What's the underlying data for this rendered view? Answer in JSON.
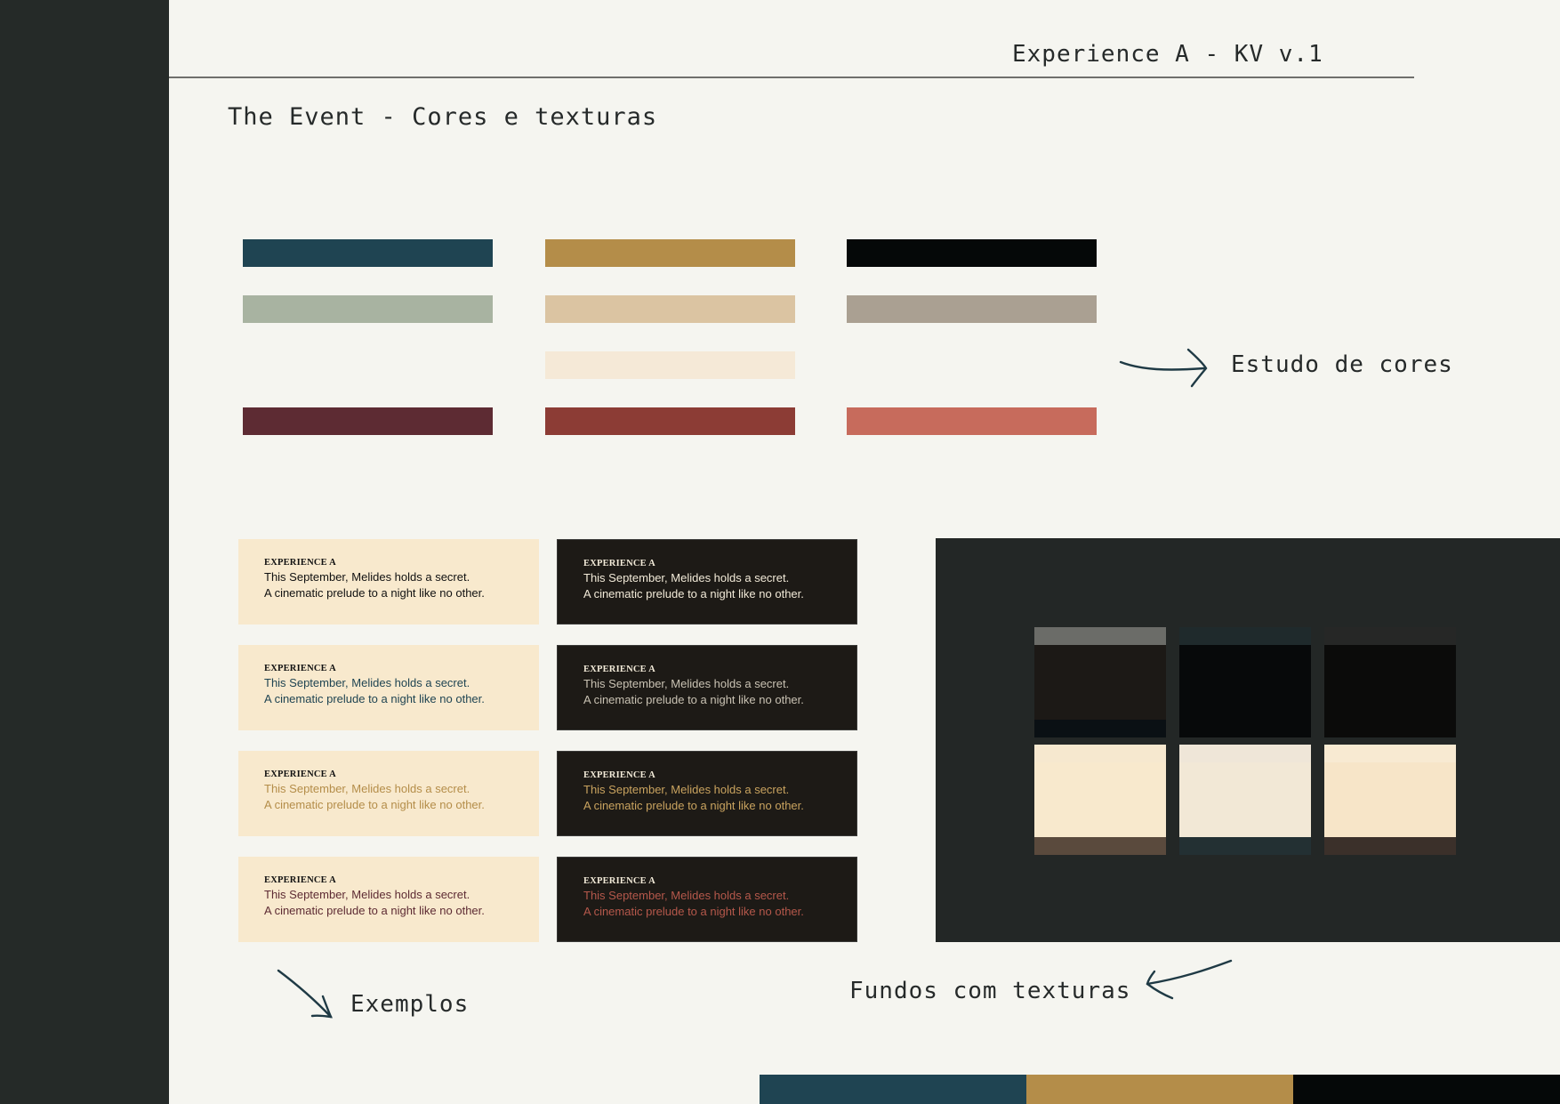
{
  "header": {
    "title": "Experience A - KV v.1"
  },
  "page_title": "The Event - Cores e texturas",
  "palette": {
    "label": "Estudo de cores",
    "rows": [
      [
        "#1f4452",
        "#b48d49",
        "#050808"
      ],
      [
        "#a8b3a1",
        "#dbc4a2",
        "#aaa092"
      ],
      [
        null,
        "#f5e9d7",
        null
      ],
      [
        "#5d2b33",
        "#8c3c35",
        "#c76b5c"
      ]
    ]
  },
  "examples": {
    "label": "Exemplos",
    "cards": [
      {
        "theme": "light",
        "brand": "EXPERIENCE A",
        "line1": "This September, Melides holds a secret.",
        "line2": "A cinematic prelude to a night like no other.",
        "text_color": "#111111"
      },
      {
        "theme": "dark",
        "brand": "EXPERIENCE A",
        "line1": "This September, Melides holds a secret.",
        "line2": "A cinematic prelude to a night like no other.",
        "text_color": "#f2ead8"
      },
      {
        "theme": "light",
        "brand": "EXPERIENCE A",
        "line1": "This September, Melides holds a secret.",
        "line2": "A cinematic prelude to a night like no other.",
        "text_color": "#1f4452"
      },
      {
        "theme": "dark",
        "brand": "EXPERIENCE A",
        "line1": "This September, Melides holds a secret.",
        "line2": "A cinematic prelude to a night like no other.",
        "text_color": "#c9c2b3"
      },
      {
        "theme": "light",
        "brand": "EXPERIENCE A",
        "line1": "This September, Melides holds a secret.",
        "line2": "A cinematic prelude to a night like no other.",
        "text_color": "#b48d49"
      },
      {
        "theme": "dark",
        "brand": "EXPERIENCE A",
        "line1": "This September, Melides holds a secret.",
        "line2": "A cinematic prelude to a night like no other.",
        "text_color": "#c9a35f"
      },
      {
        "theme": "light",
        "brand": "EXPERIENCE A",
        "line1": "This September, Melides holds a secret.",
        "line2": "A cinematic prelude to a night like no other.",
        "text_color": "#5d2b33"
      },
      {
        "theme": "dark",
        "brand": "EXPERIENCE A",
        "line1": "This September, Melides holds a secret.",
        "line2": "A cinematic prelude to a night like no other.",
        "text_color": "#b5584b"
      }
    ]
  },
  "textures": {
    "label": "Fundos com texturas",
    "tiles": [
      {
        "top": "#6b6c68",
        "main": "#1c1916",
        "bottom": "#0a1014"
      },
      {
        "top": "#1f2a2c",
        "main": "#07090a",
        "bottom": "#07090a"
      },
      {
        "top": "#262726",
        "main": "#0b0b0a",
        "bottom": "#0b0b0a"
      },
      {
        "top": "#f6e8cf",
        "main": "#f8e9cd",
        "bottom": "#5a4a3d"
      },
      {
        "top": "#efe6d8",
        "main": "#f2e8d6",
        "bottom": "#233033"
      },
      {
        "top": "#f8ead2",
        "main": "#f7e5c8",
        "bottom": "#3b302a"
      }
    ]
  },
  "bottom_bar": [
    "#1f4452",
    "#b48d49",
    "#050808"
  ]
}
